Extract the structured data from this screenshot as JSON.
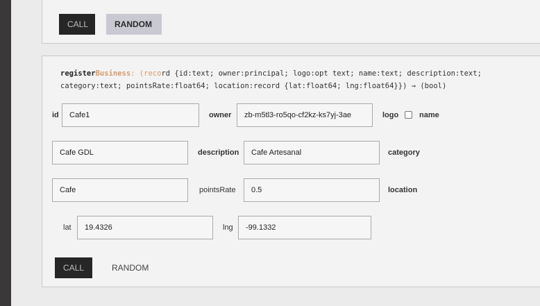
{
  "top_bar": {
    "call_label": "CALL",
    "random_label": "RANDOM"
  },
  "method": {
    "name_part1": "register",
    "name_part2": "Business",
    "sig_prefix": ": (",
    "sig_rec": "reco",
    "sig_line1_rest": "rd {id:text; owner:principal; logo:opt text; name:text; description:text;",
    "sig_line2": "category:text; pointsRate:float64; location:record {lat:float64; lng:float64}}) → (bool)"
  },
  "fields": {
    "id_label": "id",
    "id_value": "Cafe1",
    "owner_label": "owner",
    "owner_value": "zb-m5tl3-ro5qo-cf2kz-ks7yj-3ae",
    "logo_label": "logo",
    "name_label": "name",
    "name_value": "Cafe GDL",
    "description_label": "description",
    "description_value": "Cafe Artesanal",
    "category_label": "category",
    "category_value": "Cafe",
    "pointsRate_label": "pointsRate",
    "pointsRate_value": "0.5",
    "location_label": "location",
    "lat_label": "lat",
    "lat_value": "19.4326",
    "lng_label": "lng",
    "lng_value": "-99.1332"
  },
  "bottom_bar": {
    "call_label": "CALL",
    "random_label": "RANDOM"
  }
}
